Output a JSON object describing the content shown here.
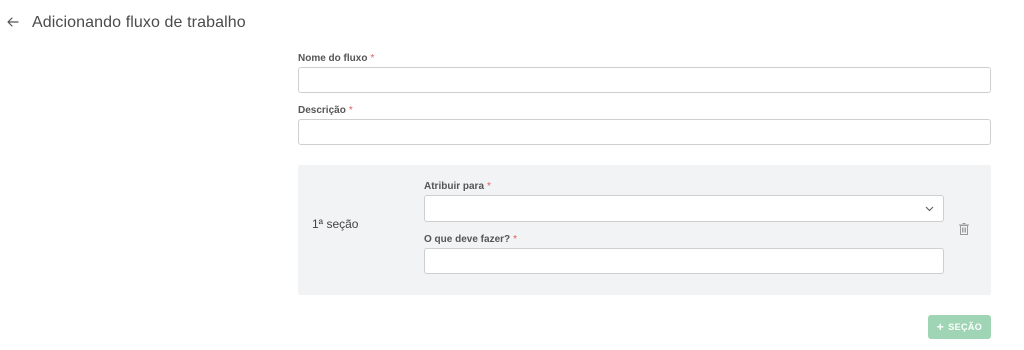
{
  "header": {
    "back_icon": "arrow-left-icon",
    "title": "Adicionando fluxo de trabalho"
  },
  "form": {
    "flow_name": {
      "label": "Nome do fluxo",
      "required_mark": "*",
      "value": ""
    },
    "description": {
      "label": "Descrição",
      "required_mark": "*",
      "value": ""
    }
  },
  "sections": [
    {
      "name": "1ª seção",
      "assign_to": {
        "label": "Atribuir para",
        "required_mark": "*",
        "selected": ""
      },
      "what_to_do": {
        "label": "O que deve fazer?",
        "required_mark": "*",
        "value": ""
      },
      "delete_icon": "trash-icon",
      "select_icon": "chevron-down-icon"
    }
  ],
  "actions": {
    "add_section_icon": "plus-icon",
    "add_section_label": "SEÇÃO"
  },
  "colors": {
    "required": "#e05a5a",
    "section_background": "#f2f3f5",
    "add_button": "#9fd5b4"
  }
}
